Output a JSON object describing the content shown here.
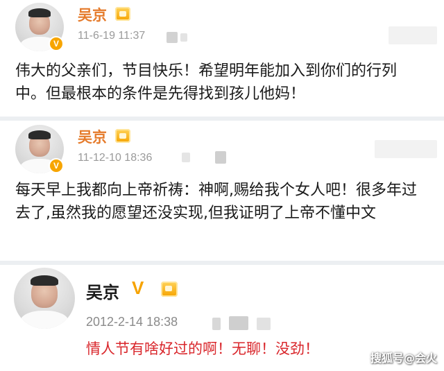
{
  "posts": [
    {
      "author": "吴京",
      "time": "11-6-19 11:37",
      "verified": "V",
      "text": "伟大的父亲们，节目快乐！希望明年能加入到你们的行列中。但最根本的条件是先得找到孩儿他妈！",
      "text_color": "#1a1a1a"
    },
    {
      "author": "吴京",
      "time": "11-12-10 18:36",
      "verified": "V",
      "text": "每天早上我都向上帝祈祷：神啊,赐给我个女人吧！很多年过去了,虽然我的愿望还没实现,但我证明了上帝不懂中文",
      "text_color": "#1a1a1a"
    },
    {
      "author": "吴京",
      "time": "2012-2-14 18:38",
      "verified": "V",
      "text": "情人节有啥好过的啊！无聊！没劲！",
      "text_color": "#d9262b"
    }
  ],
  "watermark": "搜狐号@会火",
  "colors": {
    "author_name": "#e57a2a",
    "verified_badge": "#f7a500",
    "meta_text": "#9a9a9a",
    "separator": "#eceff2"
  }
}
